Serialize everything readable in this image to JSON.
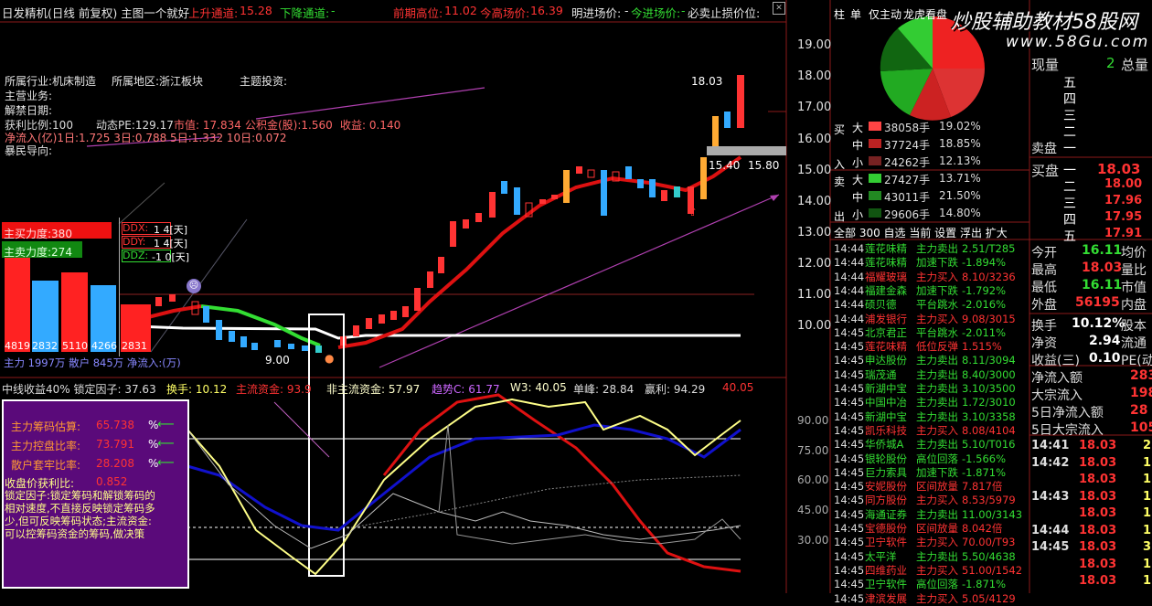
{
  "header": {
    "title": "日发精机(日线 前复权) 主图一个就好",
    "up_channel_label": "上升通道:",
    "up_channel_value": "15.28",
    "down_channel_label": "下降通道:",
    "down_channel_value": "-",
    "prev_high_label": "前期高位:",
    "prev_high_value": "11.02",
    "today_high_label": "今高场价:",
    "today_high_value": "16.39",
    "enter_label": "明进场价:",
    "enter_value": "-",
    "today_enter_label": "今进场价:",
    "today_enter_value": "-",
    "stop_label": "必卖止损价位:"
  },
  "info": {
    "industry": "所属行业:机床制造",
    "region": "所属地区:浙江板块",
    "theme": "主题投资:",
    "main_business": "主营业务:",
    "unlock_date": "解禁日期:",
    "profit_ratio": "获利比例:100",
    "pe": "动态PE:129.17",
    "market_value": "市值: 17.834",
    "reserve": "公积金(股):1.560",
    "income": "收益: 0.140",
    "net_inflow": "净流入(亿)1日:1.725 3日:0.788 5日:1.332 10日:0.072",
    "guide": "暴民导向:"
  },
  "left_panel": {
    "buy_force": "主买力度:380",
    "sell_force": "主卖力度:274",
    "ddx": "DDX:",
    "ddy": "DDY:",
    "ddz": "DDZ:",
    "ddx_tag": "1 4[天]",
    "ddy_tag": "1 4[天]",
    "ddz_tag": "-1 0[天]",
    "bars": [
      "4819",
      "2832",
      "5110",
      "4266",
      "2831"
    ],
    "bottom": "主力 1997万 散户 845万 净流入:(万)"
  },
  "price_axis": [
    "19.00",
    "18.00",
    "17.00",
    "16.00",
    "15.00",
    "14.00",
    "13.00",
    "12.00",
    "11.00",
    "10.00"
  ],
  "chart_labels": {
    "high": "18.03",
    "mid": "15.40",
    "right": "15.80",
    "low": "9.00"
  },
  "indicator": {
    "title": "中线收益40% 锁定因子: 37.63",
    "turnover": "换手: 10.12",
    "main_fund": "主流资金: 93.9",
    "non_main": "非主流资金: 57.97",
    "trend": "趋势C: 61.77",
    "w3": "W3: 40.05",
    "peak": "单峰: 28.84",
    "profit": "赢利: 94.29",
    "extra": "40.05",
    "axis": [
      "90.00",
      "75.00",
      "60.00",
      "45.00",
      "30.00"
    ]
  },
  "purple_box": {
    "row1_label": "主力筹码估算:",
    "row1_value": "65.738",
    "row2_label": "主力控盘比率:",
    "row2_value": "73.791",
    "row3_label": "散户套牢比率:",
    "row3_value": "28.208",
    "row4_label": "收盘价获利比:",
    "row4_value": "0.852",
    "note": "锁定因子:锁定筹码和解锁筹码的相对速度,不直接反映锁定筹码多少,但可反映筹码状态;主流资金:可以控筹码资金的筹码,做决策",
    "pct": "%"
  },
  "watermark": {
    "line1": "炒股辅助教材58股网",
    "line2": "www.58Gu.com"
  },
  "tabs": [
    "柱",
    "单",
    "仅主动",
    "龙虎看盘"
  ],
  "flow": {
    "buy_label": "买",
    "in_label": "入",
    "sell_label": "卖",
    "out_label": "出",
    "rows": [
      {
        "size": "大",
        "vol": "38058手",
        "pct": "19.02%"
      },
      {
        "size": "中",
        "vol": "37724手",
        "pct": "18.85%"
      },
      {
        "size": "小",
        "vol": "24262手",
        "pct": "12.13%"
      },
      {
        "size": "大",
        "vol": "27427手",
        "pct": "13.71%"
      },
      {
        "size": "中",
        "vol": "43011手",
        "pct": "21.50%"
      },
      {
        "size": "小",
        "vol": "29606手",
        "pct": "14.80%"
      }
    ],
    "filter": "全部 300 自选 当前 设置 浮出 扩大"
  },
  "tape": [
    {
      "time": "14:44",
      "name": "莲花味精",
      "action": "主力卖出",
      "val": "2.51/T285"
    },
    {
      "time": "14:44",
      "name": "莲花味精",
      "action": "加速下跌",
      "val": "-1.894%"
    },
    {
      "time": "14:44",
      "name": "福耀玻璃",
      "action": "主力买入",
      "val": "8.10/3236"
    },
    {
      "time": "14:44",
      "name": "福建金森",
      "action": "加速下跌",
      "val": "-1.792%"
    },
    {
      "time": "14:44",
      "name": "硕贝德",
      "action": "平台跳水",
      "val": "-2.016%"
    },
    {
      "time": "14:44",
      "name": "浦发银行",
      "action": "主力买入",
      "val": "9.08/3015"
    },
    {
      "time": "14:45",
      "name": "北京君正",
      "action": "平台跳水",
      "val": "-2.011%"
    },
    {
      "time": "14:45",
      "name": "莲花味精",
      "action": "低位反弹",
      "val": "1.515%"
    },
    {
      "time": "14:45",
      "name": "申达股份",
      "action": "主力卖出",
      "val": "8.11/3094"
    },
    {
      "time": "14:45",
      "name": "瑞茂通",
      "action": "主力卖出",
      "val": "8.40/3000"
    },
    {
      "time": "14:45",
      "name": "新湖中宝",
      "action": "主力卖出",
      "val": "3.10/3500"
    },
    {
      "time": "14:45",
      "name": "中国中冶",
      "action": "主力卖出",
      "val": "1.72/3010"
    },
    {
      "time": "14:45",
      "name": "新湖中宝",
      "action": "主力卖出",
      "val": "3.10/3358"
    },
    {
      "time": "14:45",
      "name": "凯乐科技",
      "action": "主力买入",
      "val": "8.08/4104"
    },
    {
      "time": "14:45",
      "name": "华侨城A",
      "action": "主力卖出",
      "val": "5.10/T016"
    },
    {
      "time": "14:45",
      "name": "银轮股份",
      "action": "高位回落",
      "val": "-1.566%"
    },
    {
      "time": "14:45",
      "name": "巨力索具",
      "action": "加速下跌",
      "val": "-1.871%"
    },
    {
      "time": "14:45",
      "name": "安妮股份",
      "action": "区间放量",
      "val": "7.817倍"
    },
    {
      "time": "14:45",
      "name": "同方股份",
      "action": "主力买入",
      "val": "8.53/5979"
    },
    {
      "time": "14:45",
      "name": "海通证券",
      "action": "主力卖出",
      "val": "11.00/3143"
    },
    {
      "time": "14:45",
      "name": "宝德股份",
      "action": "区间放量",
      "val": "8.042倍"
    },
    {
      "time": "14:45",
      "name": "卫宁软件",
      "action": "主力买入",
      "val": "70.00/T93"
    },
    {
      "time": "14:45",
      "name": "太平洋",
      "action": "主力卖出",
      "val": "5.50/4638"
    },
    {
      "time": "14:45",
      "name": "四维药业",
      "action": "主力买入",
      "val": "51.00/1542"
    },
    {
      "time": "14:45",
      "name": "卫宁软件",
      "action": "高位回落",
      "val": "-1.871%"
    },
    {
      "time": "14:45",
      "name": "津滨发展",
      "action": "主力买入",
      "val": "5.05/4129"
    }
  ],
  "quote": {
    "volume_label": "现量",
    "volume_value": "2",
    "total_label": "总量",
    "sell_levels": [
      "五",
      "四",
      "三",
      "二",
      "一"
    ],
    "sell_label": "卖盘",
    "buy_label": "买盘",
    "buy_levels": [
      {
        "level": "一",
        "price": "18.03"
      },
      {
        "level": "二",
        "price": "18.00"
      },
      {
        "level": "三",
        "price": "17.96"
      },
      {
        "level": "四",
        "price": "17.95"
      },
      {
        "level": "五",
        "price": "17.91"
      }
    ],
    "stats": [
      {
        "label": "今开",
        "value": "16.11",
        "label2": "均价"
      },
      {
        "label": "最高",
        "value": "18.03",
        "label2": "量比"
      },
      {
        "label": "最低",
        "value": "16.11",
        "label2": "市值"
      },
      {
        "label": "外盘",
        "value": "56195",
        "label2": "内盘"
      }
    ],
    "stats2": [
      {
        "label": "换手",
        "value": "10.12%",
        "label2": "股本"
      },
      {
        "label": "净资",
        "value": "2.94",
        "label2": "流通"
      },
      {
        "label": "收益(三)",
        "value": "0.10",
        "label2": "PE(动"
      }
    ],
    "flows": [
      {
        "label": "净流入额",
        "value": "283"
      },
      {
        "label": "大宗流入",
        "value": "198"
      },
      {
        "label": "5日净流入额",
        "value": "28"
      },
      {
        "label": "5日大宗流入",
        "value": "105"
      }
    ],
    "trades": [
      {
        "time": "14:41",
        "price": "18.03",
        "vol": "2"
      },
      {
        "time": "14:42",
        "price": "18.03",
        "vol": "1"
      },
      {
        "time": "",
        "price": "18.03",
        "vol": "1"
      },
      {
        "time": "14:43",
        "price": "18.03",
        "vol": "1"
      },
      {
        "time": "",
        "price": "18.03",
        "vol": "1"
      },
      {
        "time": "14:44",
        "price": "18.03",
        "vol": "1"
      },
      {
        "time": "14:45",
        "price": "18.03",
        "vol": "3"
      },
      {
        "time": "",
        "price": "18.03",
        "vol": "1"
      },
      {
        "time": "",
        "price": "18.03",
        "vol": "1"
      }
    ]
  },
  "colors": {
    "red": "#ff3333",
    "green": "#33dd33",
    "cyan": "#33cccc",
    "yellow": "#ffff33",
    "purple": "#5a0a7a",
    "magenta": "#cc44cc"
  }
}
